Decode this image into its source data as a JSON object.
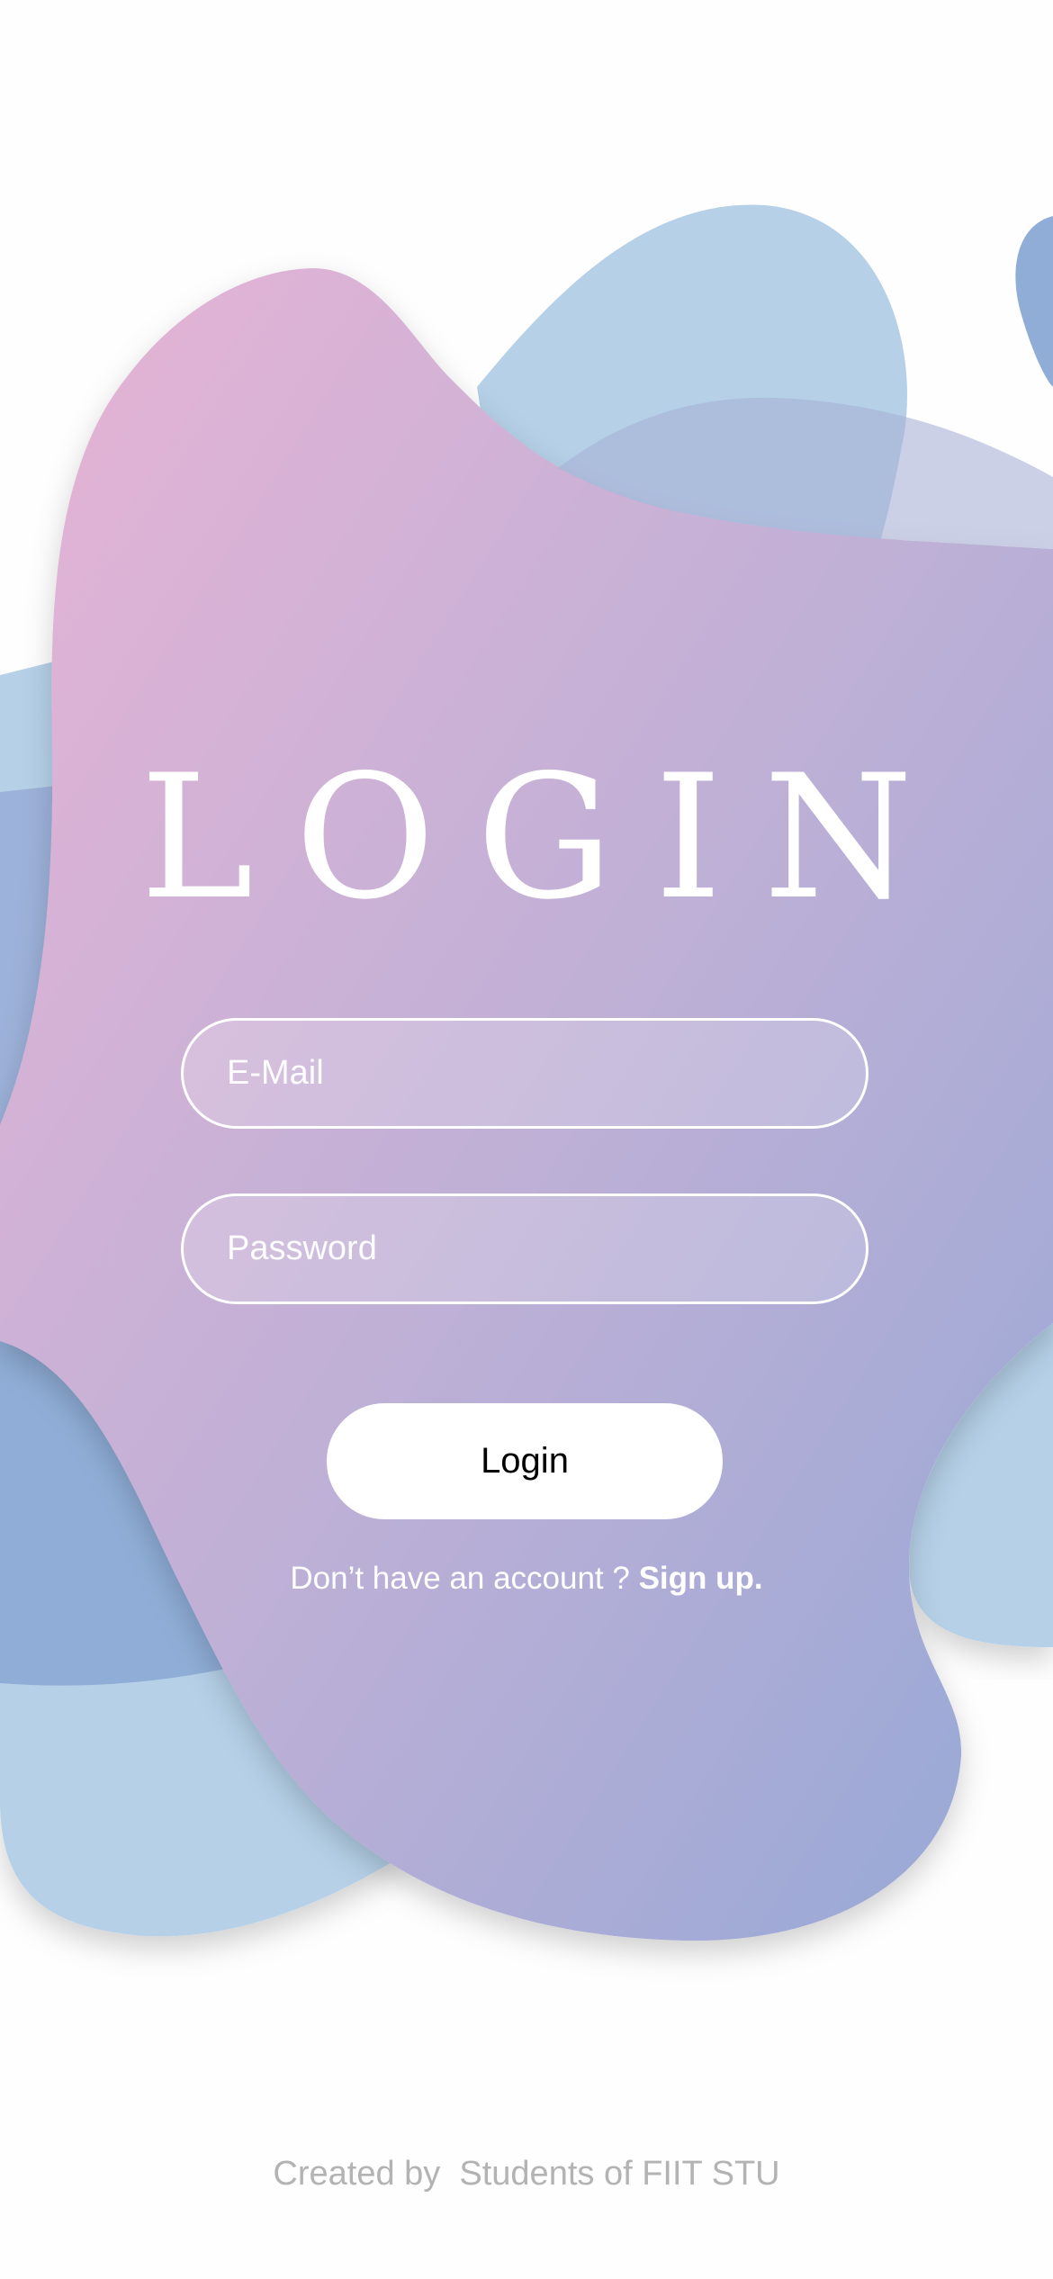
{
  "login": {
    "title": "LOGIN",
    "email_placeholder": "E-Mail",
    "password_placeholder": "Password",
    "login_button_label": "Login",
    "signup_prompt": "Don’t have an account ? ",
    "signup_link_label": "Sign up."
  },
  "footer": {
    "credit": "Created by  Students of FIIT STU"
  },
  "colors": {
    "background": "#fefefe",
    "blob_pink": "#e8b4d5",
    "blob_blue_light": "#b5d0e7",
    "blob_blue": "#8fadd6",
    "blob_lavender": "#a8acd4",
    "text_white": "#ffffff",
    "footer_gray": "#b3b3b3"
  }
}
